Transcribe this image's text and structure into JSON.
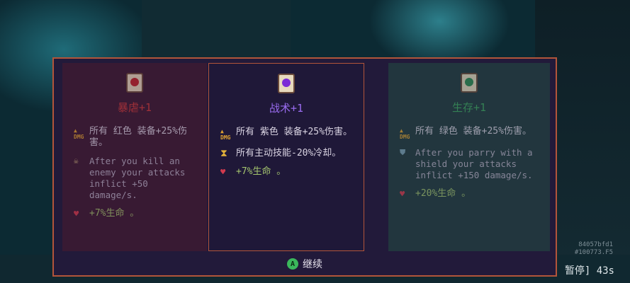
{
  "cards": [
    {
      "title": "暴虐+1",
      "color": "#cf3a3a",
      "icon": "scroll-red-icon",
      "stat": "所有 红色 装备+25%伤害。",
      "stat_icon": "DMG",
      "effect": "After you kill an enemy your attacks inflict +50 damage/s.",
      "bonus": "+7%生命 。"
    },
    {
      "title": "战术+1",
      "color": "#9a6cf0",
      "icon": "scroll-purple-icon",
      "stat": "所有 紫色 装备+25%伤害。",
      "stat_icon": "DMG",
      "effect": "所有主动技能-20%冷却。",
      "bonus": "+7%生命 。"
    },
    {
      "title": "生存+1",
      "color": "#3ea85f",
      "icon": "scroll-green-icon",
      "stat": "所有 绿色 装备+25%伤害。",
      "stat_icon": "DMG",
      "effect": "After you parry with a shield your attacks inflict +150 damage/s.",
      "bonus": "+20%生命 。"
    }
  ],
  "footer": {
    "button": "A",
    "label": "继续"
  },
  "meta": {
    "line1": "84057bfd1",
    "line2": "#100773.F5"
  },
  "pause": "暂停] 43s"
}
